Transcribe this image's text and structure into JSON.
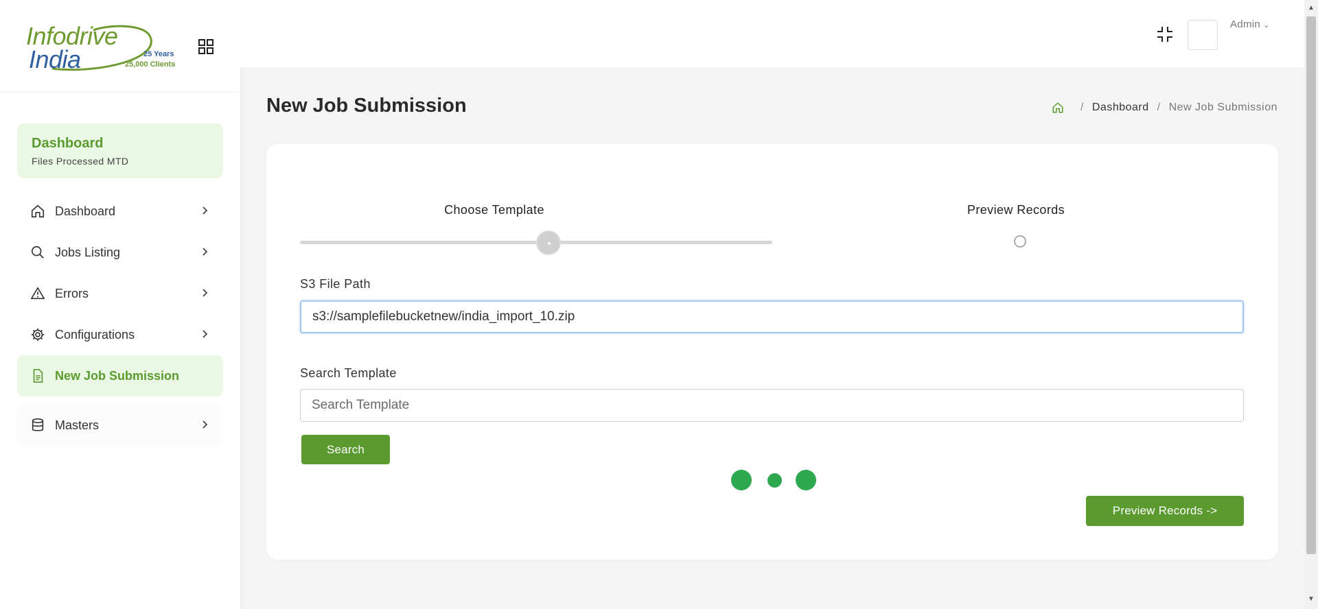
{
  "brand": {
    "line1": "Infodrive",
    "line2": "India",
    "years": "25 Years",
    "clients": "25,000 Clients"
  },
  "sidebar": {
    "card": {
      "title": "Dashboard",
      "subtitle": "Files Processed MTD"
    },
    "items": [
      {
        "label": "Dashboard",
        "icon": "home-icon"
      },
      {
        "label": "Jobs Listing",
        "icon": "search-icon"
      },
      {
        "label": "Errors",
        "icon": "warning-icon"
      },
      {
        "label": "Configurations",
        "icon": "gear-icon"
      },
      {
        "label": "New Job Submission",
        "icon": "document-icon",
        "active": true
      },
      {
        "label": "Masters",
        "icon": "database-icon"
      }
    ]
  },
  "topbar": {
    "user": "Admin"
  },
  "page": {
    "title": "New Job Submission",
    "breadcrumb": {
      "link": "Dashboard",
      "current": "New Job Submission"
    }
  },
  "wizard": {
    "steps": [
      "Choose Template",
      "Preview Records"
    ],
    "current_step": 1,
    "s3_label": "S3 File Path",
    "s3_value": "s3://samplefilebucketnew/india_import_10.zip",
    "search_label": "Search Template",
    "search_placeholder": "Search Template",
    "search_button": "Search",
    "preview_button": "Preview Records ->"
  },
  "colors": {
    "accent": "#5a9a2e",
    "accent_light": "#eaf7e4",
    "loader": "#2ea84f"
  }
}
